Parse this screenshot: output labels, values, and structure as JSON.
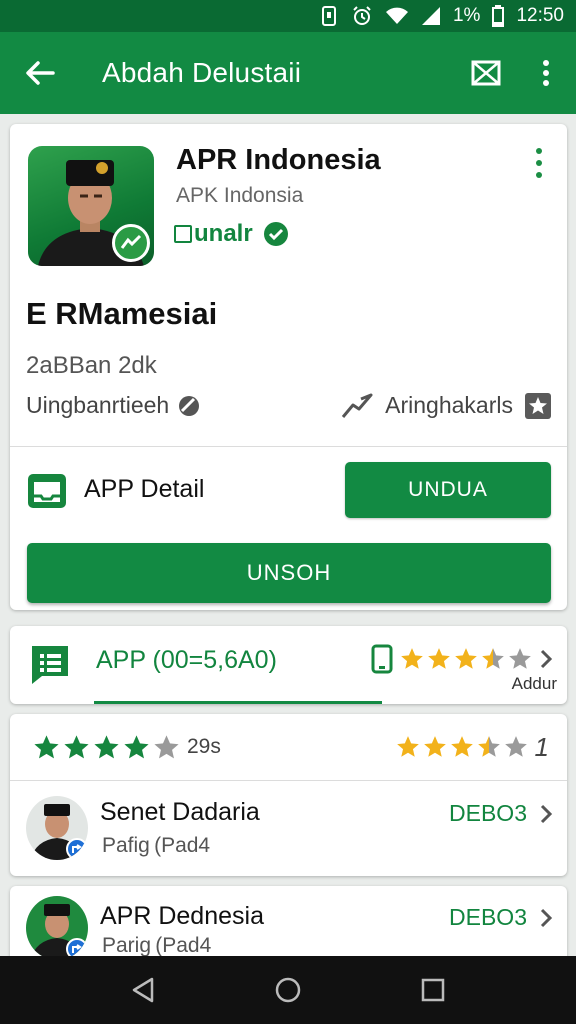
{
  "status_bar": {
    "battery": "1%",
    "time": "12:50"
  },
  "app_bar": {
    "title": "Abdah Delustaii",
    "icons": [
      "back-arrow-icon",
      "bookmark-x-icon",
      "more-vert-icon"
    ]
  },
  "app_card": {
    "name": "APR Indonesia",
    "subtitle": "APK  Indonsia",
    "verified_label": "unalr",
    "big_title": "E RMamesiai",
    "size_line": "2aBBan 2dk",
    "meta_left": "Uingbanrtieeh",
    "meta_right": "Aringhakarls",
    "detail_label": "APP Detail",
    "download_button": "UNDUA",
    "primary_button": "UNSOH"
  },
  "tab_bar": {
    "label": "APP (00=5,6A0)",
    "right_caption": "Addur",
    "stars_filled": 3.5
  },
  "ratings": {
    "left_stars_filled": 4,
    "left_count": "29s",
    "right_stars_filled": 3.5,
    "right_value": "1"
  },
  "list_items": [
    {
      "title": "Senet Dadaria",
      "subtitle": "Pafig (Pad4",
      "action": "DEBO3"
    },
    {
      "title": "APR Dednesia",
      "subtitle": "Parig (Pad4",
      "action": "DEBO3"
    }
  ],
  "colors": {
    "status_bar": "#0a6a33",
    "primary": "#128a43",
    "primary_text": "#12853f",
    "star_gold": "#f2b21b",
    "star_green": "#16863e"
  }
}
